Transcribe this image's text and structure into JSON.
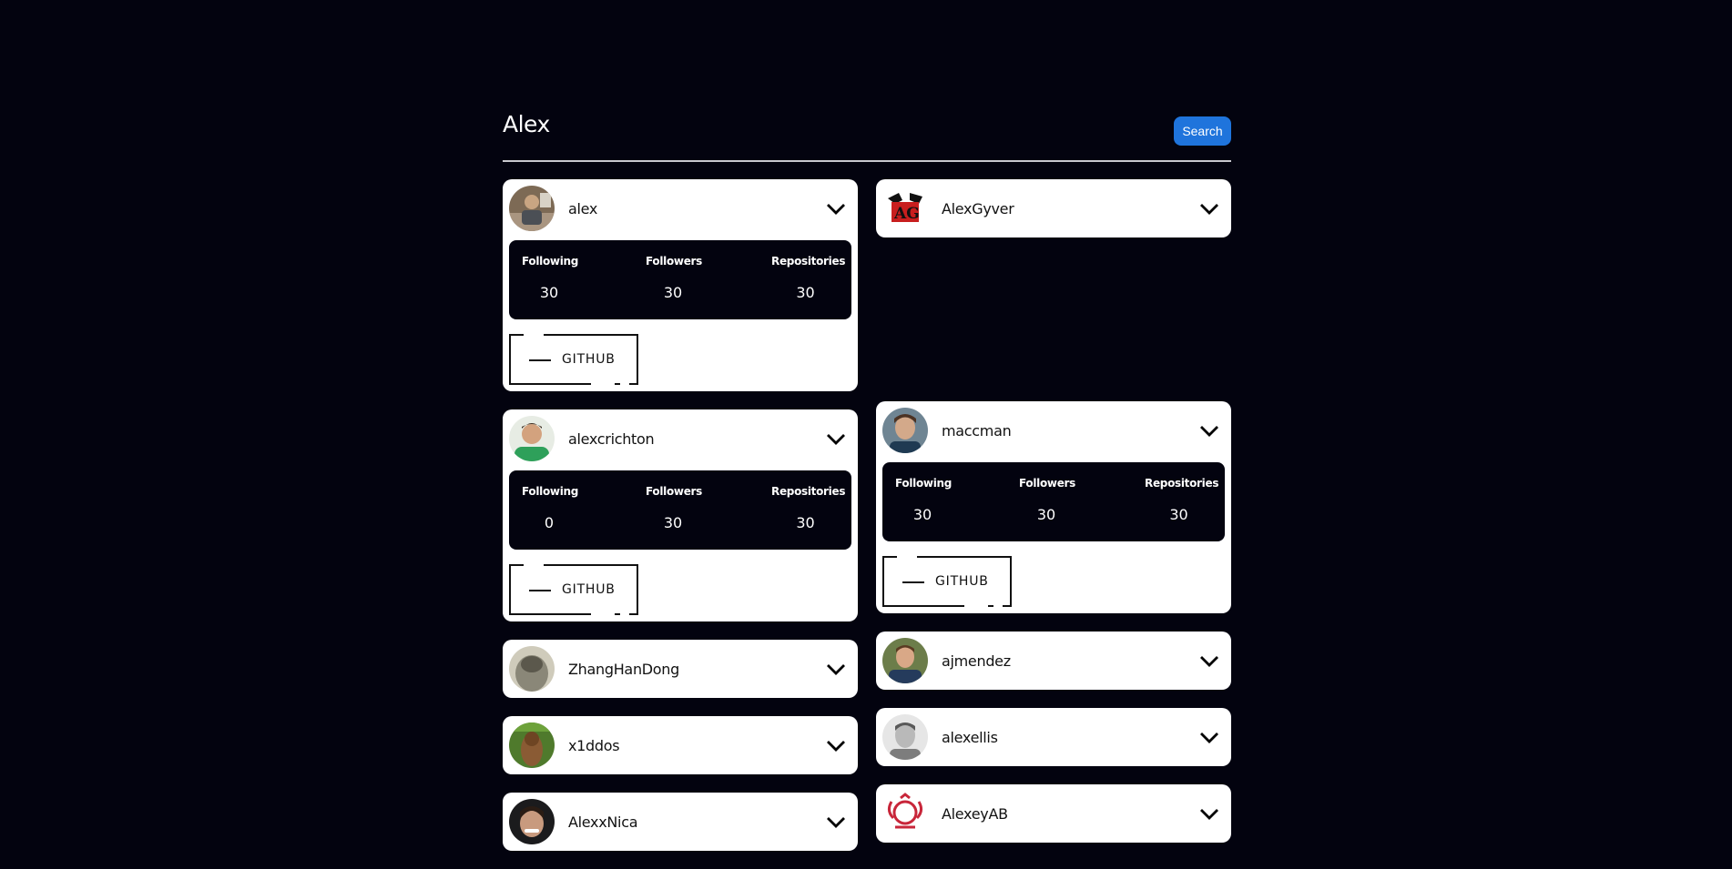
{
  "search": {
    "value": "Alex",
    "button_label": "Search"
  },
  "stat_labels": {
    "following": "Following",
    "followers": "Followers",
    "repositories": "Repositories"
  },
  "github_label": "GITHUB",
  "users": [
    {
      "login": "alex",
      "expanded": true,
      "following": "30",
      "followers": "30",
      "repositories": "30"
    },
    {
      "login": "AlexGyver",
      "expanded": false
    },
    {
      "login": "alexcrichton",
      "expanded": true,
      "following": "0",
      "followers": "30",
      "repositories": "30"
    },
    {
      "login": "maccman",
      "expanded": true,
      "following": "30",
      "followers": "30",
      "repositories": "30"
    },
    {
      "login": "ZhangHanDong",
      "expanded": false
    },
    {
      "login": "ajmendez",
      "expanded": false
    },
    {
      "login": "x1ddos",
      "expanded": false
    },
    {
      "login": "alexellis",
      "expanded": false
    },
    {
      "login": "AlexxNica",
      "expanded": false
    },
    {
      "login": "AlexeyAB",
      "expanded": false
    }
  ]
}
